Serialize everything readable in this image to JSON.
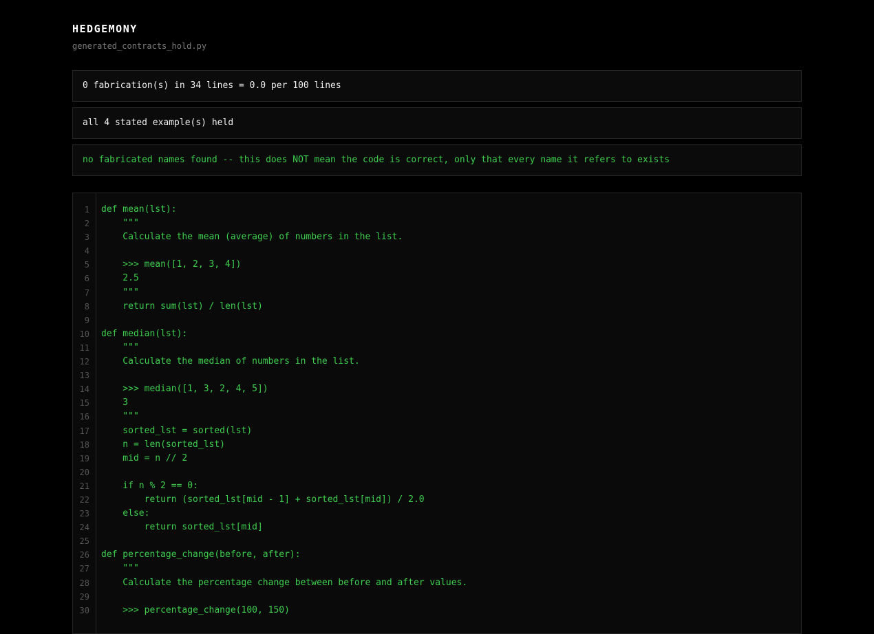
{
  "header": {
    "title": "HEDGEMONY",
    "file_name": "generated_contracts_hold.py"
  },
  "summary": {
    "fabrication_line": "0 fabrication(s) in 34 lines = 0.0 per 100 lines",
    "examples_line": "all 4 stated example(s) held",
    "note_line": "no fabricated names found -- this does NOT mean the code is correct, only that every name it refers to exists"
  },
  "colors": {
    "background": "#000000",
    "code_green": "#3ecf4e",
    "panel_border": "#262626"
  },
  "code": {
    "lines": [
      {
        "n": "1",
        "text": "def mean(lst):"
      },
      {
        "n": "2",
        "text": "    \"\"\""
      },
      {
        "n": "3",
        "text": "    Calculate the mean (average) of numbers in the list."
      },
      {
        "n": "4",
        "text": ""
      },
      {
        "n": "5",
        "text": "    >>> mean([1, 2, 3, 4])"
      },
      {
        "n": "6",
        "text": "    2.5"
      },
      {
        "n": "7",
        "text": "    \"\"\""
      },
      {
        "n": "8",
        "text": "    return sum(lst) / len(lst)"
      },
      {
        "n": "9",
        "text": ""
      },
      {
        "n": "10",
        "text": "def median(lst):"
      },
      {
        "n": "11",
        "text": "    \"\"\""
      },
      {
        "n": "12",
        "text": "    Calculate the median of numbers in the list."
      },
      {
        "n": "13",
        "text": ""
      },
      {
        "n": "14",
        "text": "    >>> median([1, 3, 2, 4, 5])"
      },
      {
        "n": "15",
        "text": "    3"
      },
      {
        "n": "16",
        "text": "    \"\"\""
      },
      {
        "n": "17",
        "text": "    sorted_lst = sorted(lst)"
      },
      {
        "n": "18",
        "text": "    n = len(sorted_lst)"
      },
      {
        "n": "19",
        "text": "    mid = n // 2"
      },
      {
        "n": "20",
        "text": ""
      },
      {
        "n": "21",
        "text": "    if n % 2 == 0:"
      },
      {
        "n": "22",
        "text": "        return (sorted_lst[mid - 1] + sorted_lst[mid]) / 2.0"
      },
      {
        "n": "23",
        "text": "    else:"
      },
      {
        "n": "24",
        "text": "        return sorted_lst[mid]"
      },
      {
        "n": "25",
        "text": ""
      },
      {
        "n": "26",
        "text": "def percentage_change(before, after):"
      },
      {
        "n": "27",
        "text": "    \"\"\""
      },
      {
        "n": "28",
        "text": "    Calculate the percentage change between before and after values."
      },
      {
        "n": "29",
        "text": ""
      },
      {
        "n": "30",
        "text": "    >>> percentage_change(100, 150)"
      }
    ]
  }
}
